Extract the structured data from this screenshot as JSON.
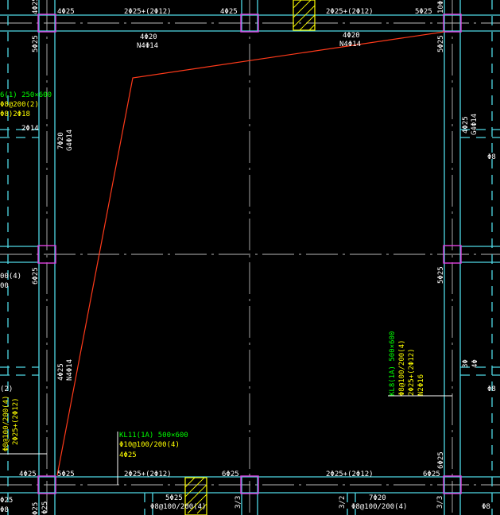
{
  "colors": {
    "background": "#000000",
    "beam": "#4fd9e6",
    "column": "#e040e0",
    "axis": "#b8b8b8",
    "rebar_text": "#ffffff",
    "beam_name_text": "#00ff00",
    "beam_spec_text": "#ffff00",
    "moment_line": "#ff3a1a",
    "hatch": "#ffff00"
  },
  "top_beam": {
    "support_left": "4Φ25",
    "mid_left": "2Φ25+(2Φ12)",
    "support_center": "4Φ25",
    "mid_right": "2Φ25+(2Φ12)",
    "support_right": "5Φ25",
    "bottom_left": "4Φ20",
    "web_left": "N4Φ14",
    "bottom_right": "4Φ20",
    "web_right": "N4Φ14",
    "top_left_cut": "4Φ25",
    "top_right_cut": "10Φ2"
  },
  "bottom_beam": {
    "support_left_outer": "4Φ25",
    "support_left": "5Φ25",
    "mid_left": "2Φ25+(2Φ12)",
    "support_center": "6Φ25",
    "mid_right": "2Φ25+(2Φ12)",
    "support_right": "6Φ25",
    "sub_left": "5Φ25",
    "stirrup_left": "Φ8@100/200(4)",
    "sub_right": "7Φ20",
    "stirrup_right": "Φ8@100/200(4)",
    "vert_a": "3/3",
    "vert_b": "3/2",
    "vert_c": "3/3",
    "left_cut": "ΦΦ@100/",
    "left_cut2": "Φ25"
  },
  "left_beam": {
    "top_support": "5Φ25",
    "bottom_left": "7Φ20",
    "web": "G4Φ14",
    "mid_support": "6Φ25",
    "lower_a": "4Φ25",
    "lower_b": "N4Φ14",
    "bottom_support": "Φ25"
  },
  "right_beam": {
    "top_support": "5Φ25",
    "waist_a": "4Φ25",
    "waist_b": "G4Φ14",
    "mid_support": "5Φ25",
    "bottom_support": "6Φ25",
    "cut_1": "Φ8",
    "cut_2": "3Φ",
    "cut_3": "4Φ",
    "cut_4": "Φ8",
    "cut_5": "Φ8"
  },
  "left_edge": {
    "beam_name": "6(1) 250×600",
    "stirrup": "Φ8@200(2)",
    "reinf": "Φ8)2Φ18",
    "rebar": "2Φ14",
    "stirrup2": "00(4)",
    "num": "00",
    "bottom": "(2)",
    "kl_a": "Φ8@100/200(4)",
    "kl_b": "2Φ25+(2Φ12)",
    "kl_c": "Φ25",
    "kl_d": "Φ8"
  },
  "annotation_kl11": {
    "name": "KL11(1A) 500×600",
    "stirrup": "Φ10@100/200(4)",
    "rebar": "4Φ25"
  },
  "annotation_kl8": {
    "name": "KL8(1A) 500×600",
    "stirrup": "Φ8@100/200(4)",
    "top": "2Φ25+(2Φ12)",
    "web": "N2Φ16"
  }
}
